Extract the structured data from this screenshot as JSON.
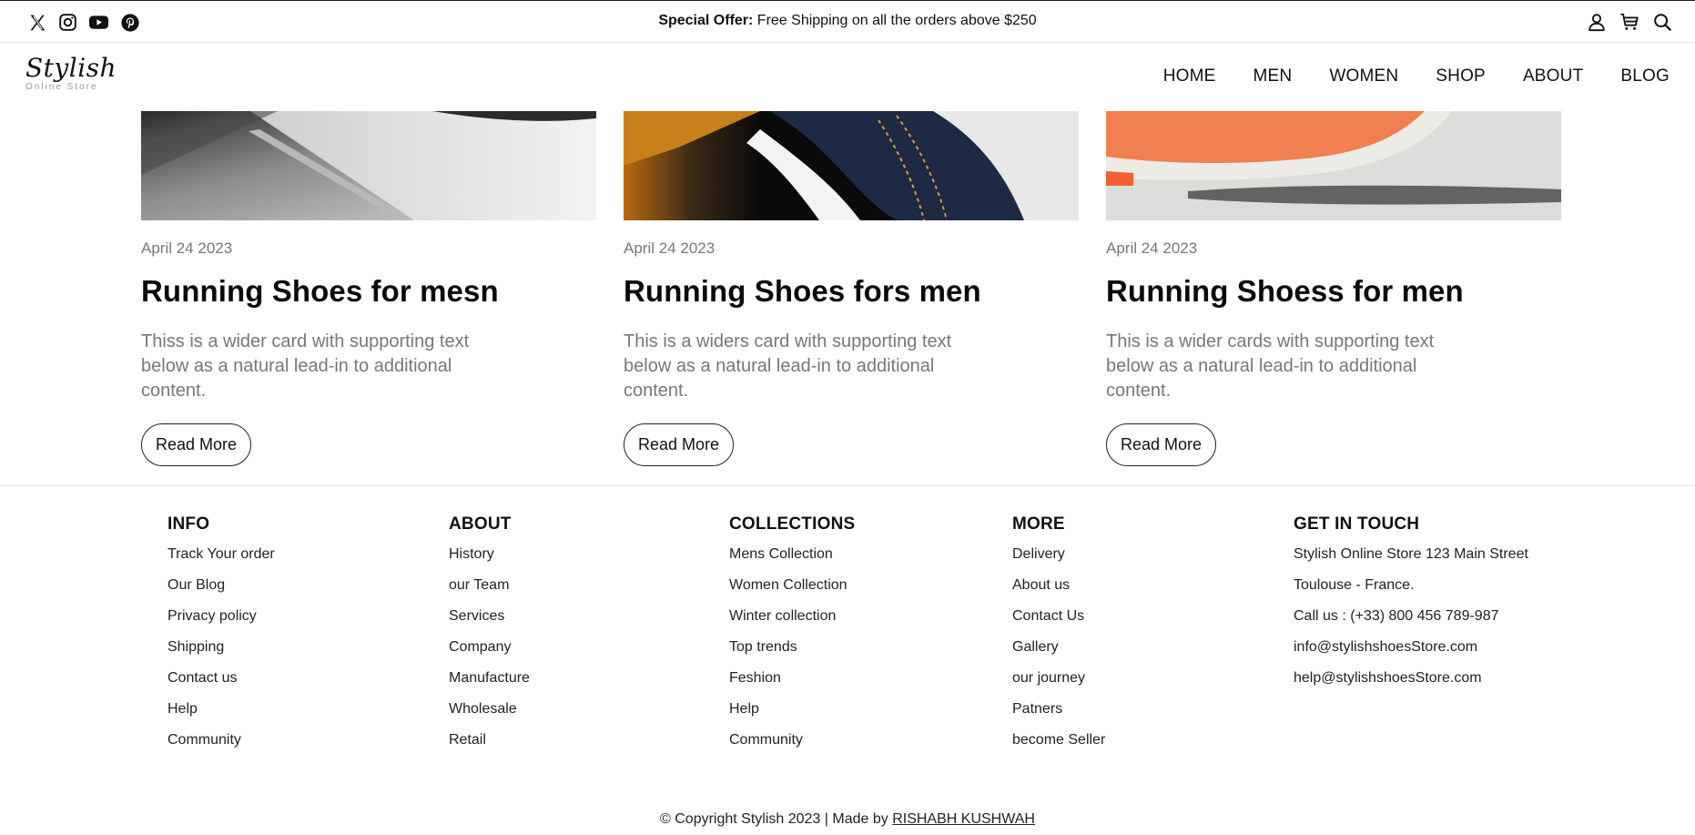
{
  "topbar": {
    "social_icons": [
      "x-icon",
      "instagram-icon",
      "youtube-icon",
      "pinterest-icon"
    ],
    "offer_label": "Special Offer:",
    "offer_text": "Free Shipping on all the orders above $250",
    "right_icons": [
      "user-icon",
      "cart-icon",
      "search-icon"
    ]
  },
  "header": {
    "logo_main": "Stylish",
    "logo_sub": "Online Store",
    "nav": [
      "HOME",
      "MEN",
      "WOMEN",
      "SHOP",
      "ABOUT",
      "BLOG"
    ]
  },
  "cards": [
    {
      "date": "April 24 2023",
      "title": "Running Shoes for mesn",
      "text": "Thiss is a wider card with supporting text below as a natural lead-in to additional content.",
      "button": "Read More"
    },
    {
      "date": "April 24 2023",
      "title": "Running Shoes fors men",
      "text": "This is a widers card with supporting text below as a natural lead-in to additional content.",
      "button": "Read More"
    },
    {
      "date": "April 24 2023",
      "title": "Running Shoess for men",
      "text": "This is a wider cards with supporting text below as a natural lead-in to additional content.",
      "button": "Read More"
    }
  ],
  "footer": {
    "columns": [
      {
        "heading": "INFO",
        "items": [
          "Track Your order",
          "Our Blog",
          "Privacy policy",
          "Shipping",
          "Contact us",
          "Help",
          "Community"
        ]
      },
      {
        "heading": "ABOUT",
        "items": [
          "History",
          "our Team",
          "Services",
          "Company",
          "Manufacture",
          "Wholesale",
          "Retail"
        ]
      },
      {
        "heading": "COLLECTIONS",
        "items": [
          "Mens Collection",
          "Women Collection",
          "Winter collection",
          "Top trends",
          "Feshion",
          "Help",
          "Community"
        ]
      },
      {
        "heading": "MORE",
        "items": [
          "Delivery",
          "About us",
          "Contact Us",
          "Gallery",
          "our journey",
          "Patners",
          "become Seller"
        ]
      },
      {
        "heading": "GET IN TOUCH",
        "items": [
          "Stylish Online Store 123 Main Street",
          "Toulouse - France.",
          "Call us : (+33) 800 456 789-987",
          "info@stylishshoesStore.com",
          "help@stylishshoesStore.com"
        ]
      }
    ],
    "copyright": "© Copyright Stylish 2023 | Made by",
    "author": "RISHABH KUSHWAH"
  }
}
